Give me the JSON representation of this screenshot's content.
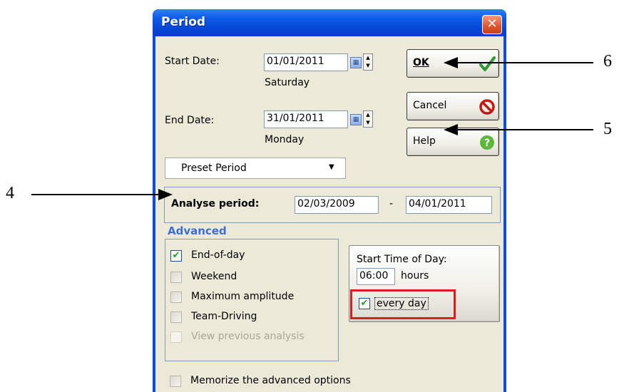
{
  "dialog": {
    "title": "Period",
    "close_symbol": "✕"
  },
  "dates": {
    "start_label": "Start Date:",
    "start_value": "01/01/2011",
    "start_day": "Saturday",
    "end_label": "End Date:",
    "end_value": "31/01/2011",
    "end_day": "Monday"
  },
  "buttons": {
    "ok": "OK",
    "cancel": "Cancel",
    "help": "Help"
  },
  "preset": {
    "selected": "Preset Period"
  },
  "analyse": {
    "label": "Analyse period:",
    "from": "02/03/2009",
    "separator": "-",
    "to": "04/01/2011"
  },
  "advanced": {
    "title": "Advanced",
    "options": [
      {
        "label": "End-of-day",
        "checked": true,
        "enabled": true
      },
      {
        "label": "Weekend",
        "checked": false,
        "enabled": true
      },
      {
        "label": "Maximum amplitude",
        "checked": false,
        "enabled": true
      },
      {
        "label": "Team-Driving",
        "checked": false,
        "enabled": true
      },
      {
        "label": "View previous analysis",
        "checked": false,
        "enabled": false
      }
    ]
  },
  "start_time": {
    "label": "Start Time of Day:",
    "value": "06:00",
    "unit": "hours",
    "every_day_label": "every day",
    "every_day_checked": true
  },
  "memorize": {
    "label": "Memorize the advanced options",
    "checked": false
  },
  "callouts": {
    "c4": "4",
    "c5": "5",
    "c6": "6"
  },
  "colors": {
    "titlebar": "#0b5ae5",
    "dialog_bg": "#ece9d8",
    "highlight_box": "#e01b1b",
    "accent_blue": "#3a6fd8",
    "check_green": "#21a121"
  }
}
